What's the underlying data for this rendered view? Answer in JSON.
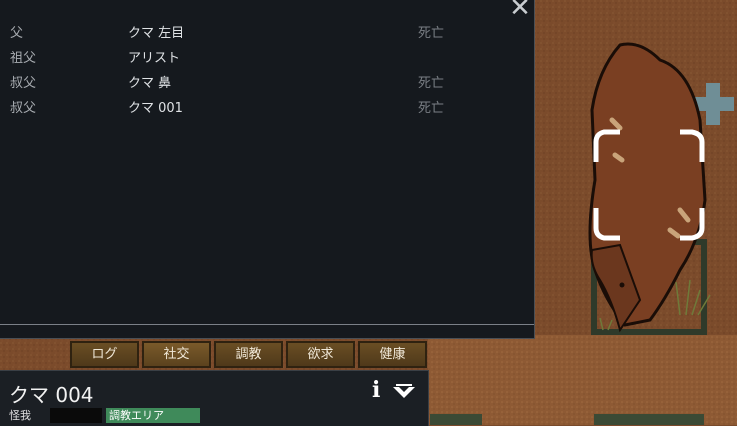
{
  "close_icon": "close-icon",
  "relations": [
    {
      "relation": "父",
      "name": "クマ 左目",
      "status": "死亡"
    },
    {
      "relation": "祖父",
      "name": "アリスト",
      "status": ""
    },
    {
      "relation": "叔父",
      "name": "クマ 鼻",
      "status": "死亡"
    },
    {
      "relation": "叔父",
      "name": "クマ 001",
      "status": "死亡"
    }
  ],
  "tabs": [
    {
      "label": "ログ"
    },
    {
      "label": "社交"
    },
    {
      "label": "調教"
    },
    {
      "label": "欲求"
    },
    {
      "label": "健康"
    }
  ],
  "inspect": {
    "name": "クマ 004",
    "info_icon": "i",
    "health_label": "怪我",
    "area_label": "調教エリア"
  },
  "colors": {
    "panel_bg": "#15191e",
    "tab_bg": "#5b421e",
    "area_tag": "#3f8a5a",
    "ground": "#7a4a2a"
  }
}
